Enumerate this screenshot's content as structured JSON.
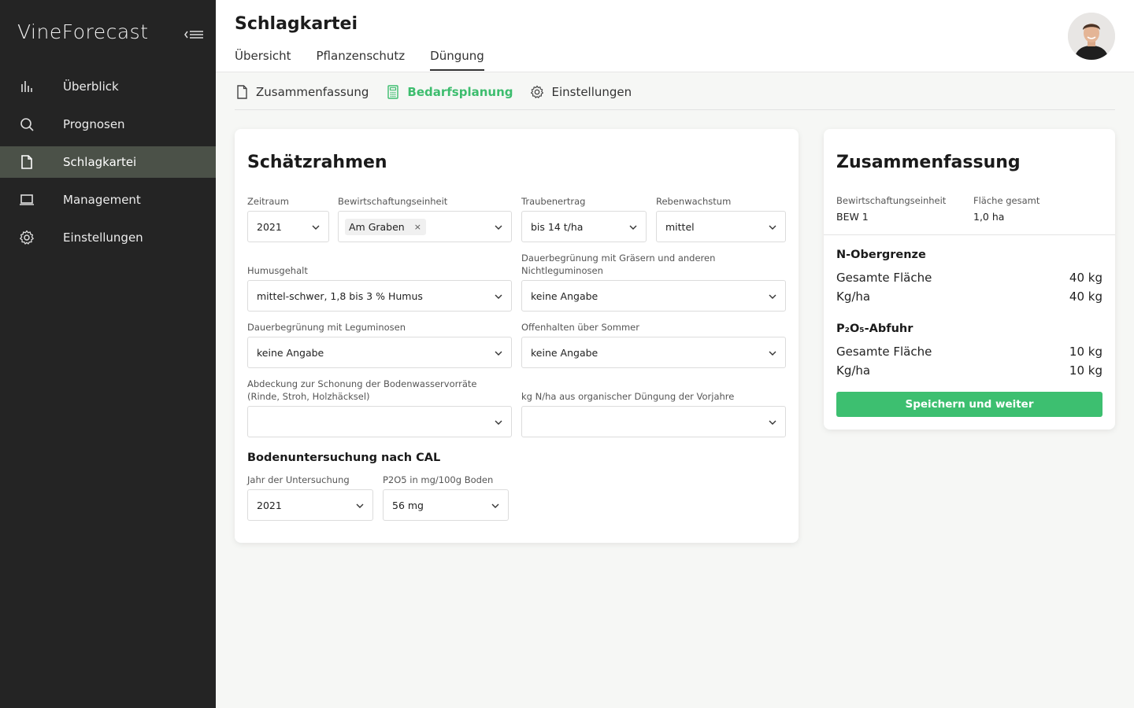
{
  "app": {
    "logo": "VineForecast"
  },
  "sidebar": {
    "items": [
      {
        "label": "Überblick",
        "icon": "bar-chart-icon"
      },
      {
        "label": "Prognosen",
        "icon": "search-icon"
      },
      {
        "label": "Schlagkartei",
        "icon": "file-icon",
        "active": true
      },
      {
        "label": "Management",
        "icon": "laptop-icon"
      },
      {
        "label": "Einstellungen",
        "icon": "gear-icon"
      }
    ]
  },
  "header": {
    "title": "Schlagkartei",
    "tabs": [
      {
        "label": "Übersicht"
      },
      {
        "label": "Pflanzenschutz"
      },
      {
        "label": "Düngung",
        "active": true
      }
    ]
  },
  "subtabs": [
    {
      "label": "Zusammenfassung",
      "icon": "file-icon"
    },
    {
      "label": "Bedarfsplanung",
      "icon": "calculator-icon",
      "active": true
    },
    {
      "label": "Einstellungen",
      "icon": "gear-icon"
    }
  ],
  "form": {
    "title": "Schätzrahmen",
    "zeitraum": {
      "label": "Zeitraum",
      "value": "2021"
    },
    "bewirtschaftungseinheit": {
      "label": "Bewirtschaftungseinheit",
      "chip": "Am Graben",
      "chip_remove": "×"
    },
    "traubenertrag": {
      "label": "Traubenertrag",
      "value": "bis 14 t/ha"
    },
    "rebenwachstum": {
      "label": "Rebenwachstum",
      "value": "mittel"
    },
    "humusgehalt": {
      "label": "Humusgehalt",
      "value": "mittel-schwer, 1,8 bis 3 % Humus"
    },
    "dauerbegruenung_graeser": {
      "label_line1": "Dauerbegrünung mit Gräsern und anderen",
      "label_line2": "Nichtleguminosen",
      "value": "keine Angabe"
    },
    "dauerbegruenung_leguminosen": {
      "label": "Dauerbegrünung mit Leguminosen",
      "value": "keine Angabe"
    },
    "offenhalten": {
      "label": "Offenhalten über Sommer",
      "value": "keine Angabe"
    },
    "abdeckung": {
      "label_line1": "Abdeckung zur Schonung der Bodenwasservorräte",
      "label_line2": "(Rinde, Stroh, Holzhäcksel)",
      "value": ""
    },
    "organische_duengung": {
      "label": "kg N/ha aus organischer Düngung der Vorjahre",
      "value": ""
    },
    "bodenuntersuchung": {
      "heading": "Bodenuntersuchung nach CAL",
      "jahr": {
        "label": "Jahr der Untersuchung",
        "value": "2021"
      },
      "p2o5": {
        "label": "P2O5 in mg/100g Boden",
        "value": "56 mg"
      }
    }
  },
  "summary": {
    "title": "Zusammenfassung",
    "unit_label": "Bewirtschaftungseinheit",
    "unit_value": "BEW 1",
    "area_label": "Fläche gesamt",
    "area_value": "1,0 ha",
    "n_heading": "N-Obergrenze",
    "n_rows": [
      {
        "label": "Gesamte Fläche",
        "value": "40 kg"
      },
      {
        "label": "Kg/ha",
        "value": "40 kg"
      }
    ],
    "p_heading": "P₂O₅-Abfuhr",
    "p_rows": [
      {
        "label": "Gesamte Fläche",
        "value": "10 kg"
      },
      {
        "label": "Kg/ha",
        "value": "10 kg"
      }
    ],
    "button": "Speichern und weiter"
  },
  "colors": {
    "sidebar_bg": "#242424",
    "sidebar_active": "#4b5148",
    "accent_green": "#3dbf70"
  }
}
